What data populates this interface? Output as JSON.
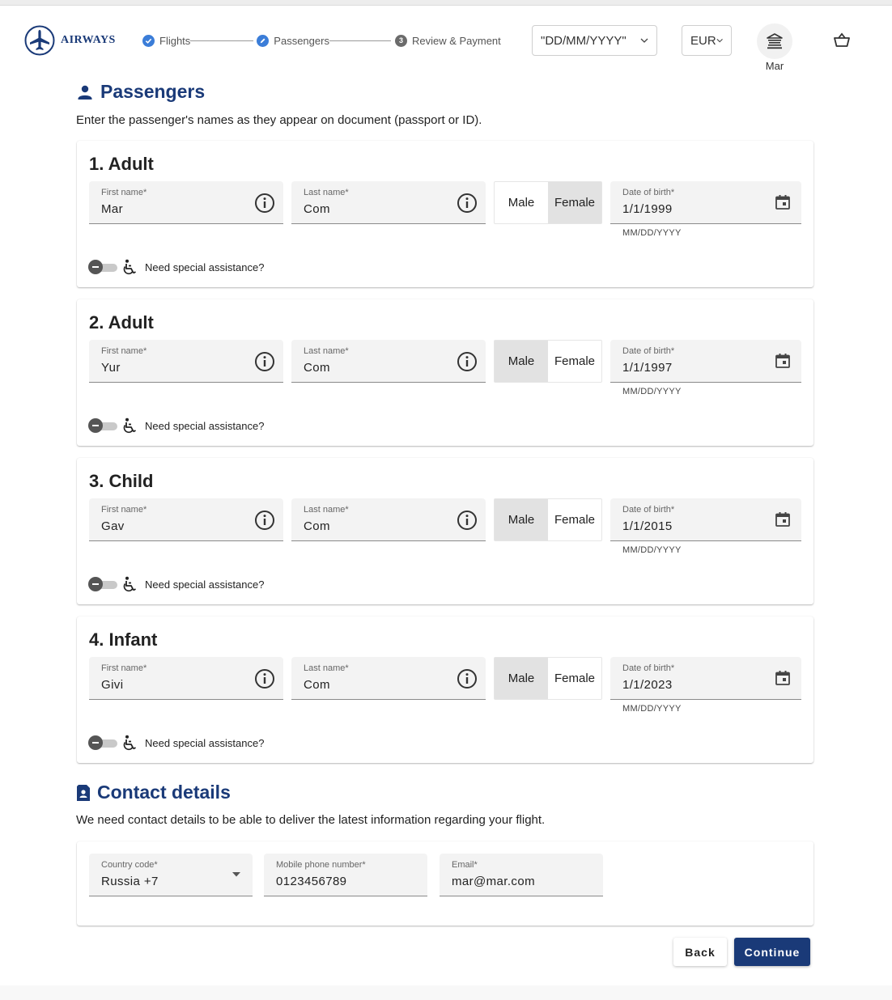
{
  "header": {
    "brand": "AIRWAYS",
    "steps": [
      {
        "label": "Flights",
        "state": "done"
      },
      {
        "label": "Passengers",
        "state": "active"
      },
      {
        "label": "Review & Payment",
        "state": "pending",
        "number": "3"
      }
    ],
    "date_format_select": "\"DD/MM/YYYY\"",
    "currency_select": "EUR",
    "user_name": "Mar",
    "icons": [
      "airplane-logo-icon",
      "check-icon",
      "pencil-icon",
      "bank-icon",
      "basket-icon",
      "chevron-down-icon"
    ]
  },
  "passengers_section": {
    "title": "Passengers",
    "description": "Enter the passenger's names as they appear on document (passport or ID).",
    "labels": {
      "first_name": "First name*",
      "last_name": "Last name*",
      "male": "Male",
      "female": "Female",
      "dob": "Date of birth*",
      "dob_hint": "MM/DD/YYYY",
      "assistance": "Need special assistance?"
    },
    "passengers": [
      {
        "title": "1. Adult",
        "first_name": "Mar",
        "last_name": "Com",
        "gender": "Female",
        "dob": "1/1/1999",
        "special_assistance": false
      },
      {
        "title": "2. Adult",
        "first_name": "Yur",
        "last_name": "Com",
        "gender": "Male",
        "dob": "1/1/1997",
        "special_assistance": false
      },
      {
        "title": "3. Child",
        "first_name": "Gav",
        "last_name": "Com",
        "gender": "Male",
        "dob": "1/1/2015",
        "special_assistance": false
      },
      {
        "title": "4. Infant",
        "first_name": "Givi",
        "last_name": "Com",
        "gender": "Male",
        "dob": "1/1/2023",
        "special_assistance": false
      }
    ]
  },
  "contact_section": {
    "title": "Contact details",
    "description": "We need contact details to be able to deliver the latest information regarding your flight.",
    "country_code_label": "Country code*",
    "country_code_value": "Russia +7",
    "phone_label": "Mobile phone number*",
    "phone_value": "0123456789",
    "email_label": "Email*",
    "email_value": "mar@mar.com"
  },
  "actions": {
    "back": "Back",
    "continue": "Continue"
  },
  "colors": {
    "brand": "#1a3a78",
    "step_done": "#3b7dd8",
    "field_bg": "#f3f3f3",
    "gender_selected": "#e2e2e2"
  }
}
